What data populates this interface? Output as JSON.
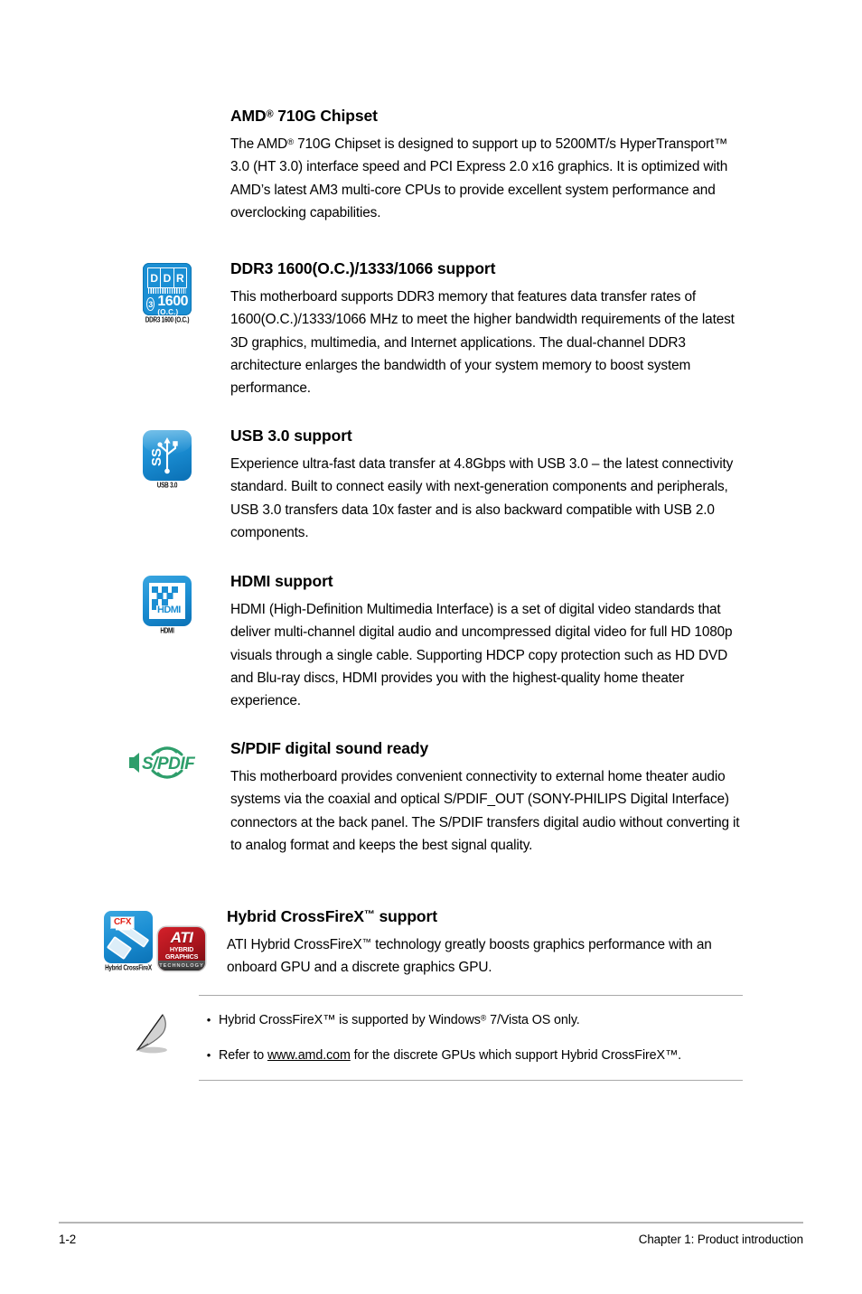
{
  "page": {
    "footer_page_number": "1-2",
    "footer_chapter": "Chapter 1: Product introduction"
  },
  "features": [
    {
      "id": "amd-710g-chipset",
      "title_prefix": "AMD",
      "title_sup": "®",
      "title_suffix": " 710G Chipset",
      "body_part1": "The AMD",
      "body_sup1": "®",
      "body_part2": " 710G Chipset is designed to support up to 5200MT/s HyperTransport™ 3.0 (HT 3.0) interface speed and PCI Express 2.0 x16 graphics. It is optimized with AMD’s latest AM3 multi-core CPUs to provide excellent system performance and overclocking capabilities.",
      "icon": null
    },
    {
      "id": "ddr3-support",
      "title": "DDR3 1600(O.C.)/1333/1066 support",
      "body": "This motherboard supports DDR3 memory that features data transfer rates of 1600(O.C.)/1333/1066 MHz to meet the higher bandwidth requirements of the latest 3D graphics, multimedia, and Internet applications. The dual-channel DDR3 architecture enlarges the bandwidth of your system memory to boost system performance.",
      "icon": {
        "name": "ddr3-1600-icon",
        "caption": "DDR3 1600 (O.C.)",
        "letters": [
          "D",
          "D",
          "R"
        ],
        "circle_number": "3",
        "speed": "1600",
        "oc_label": "(O.C.)",
        "color": "#1b8fd4"
      }
    },
    {
      "id": "usb-30-support",
      "title": "USB 3.0 support",
      "body": "Experience ultra-fast data transfer at 4.8Gbps with USB 3.0 – the latest connectivity standard. Built to connect easily with next-generation components and peripherals, USB 3.0 transfers data 10x faster and is also backward compatible with USB 2.0 components.",
      "icon": {
        "name": "usb-30-icon",
        "caption": "USB 3.0",
        "mark": "SS",
        "color": "#1b8ed3"
      }
    },
    {
      "id": "hdmi-support",
      "title": "HDMI support",
      "body": "HDMI (High-Definition Multimedia Interface) is a set of digital video standards that deliver multi-channel digital audio and uncompressed digital video for full HD 1080p visuals through a single cable. Supporting HDCP copy protection such as HD DVD and Blu-ray discs, HDMI provides you with the highest-quality home theater experience.",
      "icon": {
        "name": "hdmi-icon",
        "caption": "HDMI",
        "wordmark": "HDMI",
        "color": "#1b8ed3"
      }
    },
    {
      "id": "spdif-support",
      "title": "S/PDIF digital sound ready",
      "body": "This motherboard provides convenient connectivity to external home theater audio systems via the coaxial and optical S/PDIF_OUT (SONY-PHILIPS Digital Interface) connectors at the back panel. The S/PDIF transfers digital audio without converting it to analog format and keeps the best signal quality.",
      "icon": {
        "name": "spdif-icon",
        "wordmark": "S/PDIF",
        "color": "#2e9e6b"
      }
    },
    {
      "id": "hybrid-crossfirex-support",
      "title_prefix": "Hybrid CrossFireX",
      "title_sup": "™",
      "title_suffix": " support",
      "body_part1": "ATI Hybrid CrossFireX",
      "body_sup1": "™",
      "body_part2": " technology greatly boosts graphics performance with an onboard GPU and a discrete graphics GPU.",
      "icon": {
        "name": "hybrid-crossfirex-icon",
        "caption": "Hybrid CrossFireX",
        "tag": "CFX",
        "color": "#1b8ed3"
      },
      "icon2": {
        "name": "ati-hybrid-graphics-icon",
        "word": "ATI",
        "sub_line1": "HYBRID",
        "sub_line2": "GRAPHICS",
        "tech": "TECHNOLOGY",
        "color": "#c0151d"
      }
    }
  ],
  "note": {
    "icon_name": "note-pencil-icon",
    "bullet": "•",
    "items": [
      {
        "part1": "Hybrid CrossFireX™ is supported by Windows",
        "sup": "®",
        "part2": " 7/Vista OS only."
      },
      {
        "part1": "Refer to ",
        "link": "www.amd.com",
        "part2": " for the discrete GPUs which support Hybrid CrossFireX™."
      }
    ]
  }
}
